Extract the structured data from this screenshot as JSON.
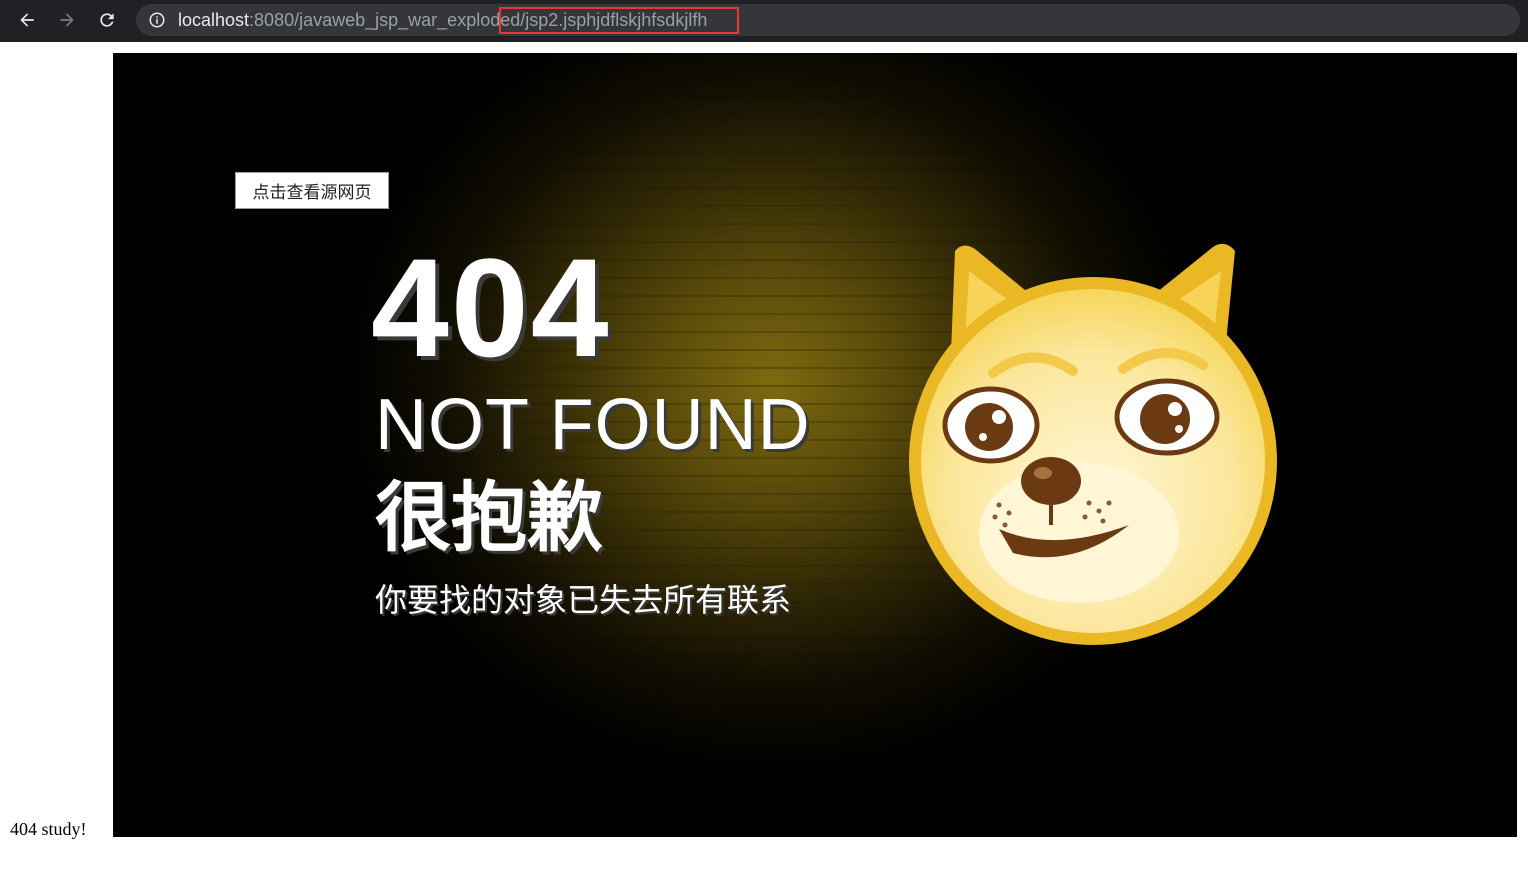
{
  "browser": {
    "url_host": "localhost",
    "url_rest": ":8080/javaweb_jsp_war_exploded/jsp2.jsphjdflskjhfsdkjlfh"
  },
  "page": {
    "caption": "404 study!",
    "view_source_button": "点击查看源网页",
    "code": "404",
    "not_found": "NOT FOUND",
    "sorry": "很抱歉",
    "message": "你要找的对象已失去所有联系"
  },
  "colors": {
    "highlight": "#e53935",
    "toolbar": "#202124",
    "glow": "#7d6a0f",
    "doge_face": "#fbe69a",
    "doge_rim": "#e9b824"
  },
  "icons": [
    "back-arrow-icon",
    "forward-arrow-icon",
    "reload-icon",
    "info-icon",
    "doge-emoji-icon"
  ]
}
